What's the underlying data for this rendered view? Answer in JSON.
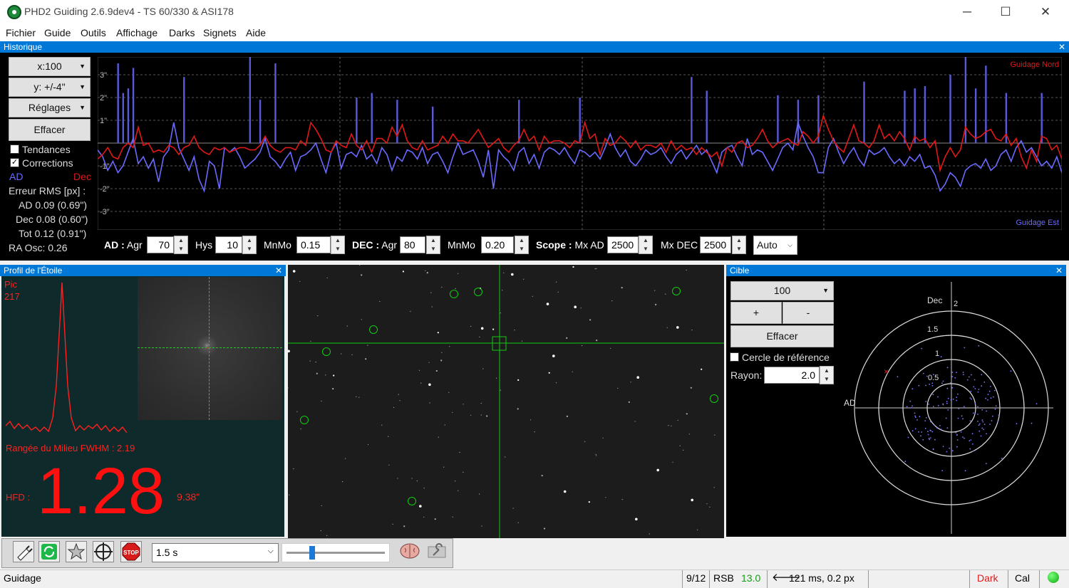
{
  "window": {
    "title": "PHD2 Guiding 2.6.9dev4 - TS 60/330 & ASI178",
    "minimize": "─",
    "maximize": "☐",
    "close": "✕"
  },
  "menu": [
    "Fichier",
    "Guide",
    "Outils",
    "Affichage",
    "Darks",
    "Signets",
    "Aide"
  ],
  "history": {
    "title": "Historique",
    "close": "✕",
    "x_scale": "x:100",
    "y_scale": "y: +/-4\"",
    "settings": "Réglages",
    "clear": "Effacer",
    "trends_label": "Tendances",
    "trends_checked": false,
    "corrections_label": "Corrections",
    "corrections_checked": true,
    "ra_label": "AD",
    "dec_label": "Dec",
    "rms_title": "Erreur RMS [px] :",
    "rms_ra": "AD 0.09 (0.69\")",
    "rms_dec": "Dec 0.08 (0.60\")",
    "rms_tot": "Tot 0.12 (0.91\")",
    "ra_osc": "RA Osc: 0.26",
    "y_ticks": [
      "3\"",
      "2\"",
      "1\"",
      "-1\"",
      "-2\"",
      "-3\""
    ],
    "north_label": "Guidage Nord",
    "east_label": "Guidage Est",
    "colors": {
      "ra": "#6a6aff",
      "dec": "#e01818"
    },
    "ra_series": [
      -0.3,
      -0.6,
      -1.2,
      -0.8,
      -1.3,
      -1.0,
      -0.4,
      0.2,
      -0.9,
      -0.6,
      -1.1,
      -0.7,
      -1.7,
      -0.6,
      -0.3,
      0.9,
      -0.2,
      -0.7,
      -1.2,
      -0.6,
      -1.6,
      -2.1,
      -0.8,
      -1.0,
      -2.0,
      -0.2,
      -0.4,
      -0.2,
      -0.6,
      -1.1,
      -0.9,
      -0.7,
      -0.4,
      0.2,
      -0.6,
      -0.8,
      -1.1,
      -0.7,
      -0.4,
      -1.2,
      -0.6,
      -0.5,
      -0.3,
      0.0,
      -0.7,
      -1.3,
      -0.4,
      0.0,
      -1.1,
      -0.5,
      -0.4,
      -0.6,
      -0.1,
      -0.7,
      -0.5,
      -0.9,
      -0.2,
      -0.5,
      -1.2,
      -0.6,
      -0.8,
      -0.3,
      -0.4,
      -0.7,
      -0.2,
      -0.9,
      -0.5,
      -0.4,
      -0.8,
      -1.3,
      -0.6,
      0.0,
      -0.5,
      -0.4,
      -0.3,
      -0.8,
      -1.5,
      -0.3,
      -2.0,
      -0.3,
      -0.6,
      -0.8,
      -1.2,
      -0.4,
      -0.2,
      -0.9,
      -0.5,
      -1.1,
      -0.4,
      -0.2,
      -0.3,
      -0.5,
      -0.2,
      -0.6,
      -0.9,
      -0.3,
      -0.4,
      -0.6,
      -0.4,
      -0.7,
      -0.2,
      0.4,
      -0.2,
      -0.6,
      -0.3,
      -0.8,
      -1.0,
      -0.7,
      -0.3,
      -0.5,
      -0.4,
      -0.2,
      -0.6,
      -0.9,
      -0.5,
      -0.3,
      -0.7,
      -0.4,
      -0.1,
      -0.5,
      -0.3,
      -0.8,
      -1.3,
      -0.4,
      -0.2,
      -0.1,
      -0.6,
      -1.0,
      0.2,
      -0.5,
      -0.3,
      -0.4,
      -0.8,
      -1.2,
      -0.7,
      -0.2,
      0.0,
      -0.3,
      0.9,
      0.3,
      -0.2,
      -0.6,
      -1.3,
      -1.3,
      -0.2,
      0.2,
      -0.4,
      -0.9,
      -0.5,
      -0.2,
      -0.7,
      -1.0,
      -0.3,
      -0.5,
      -0.4,
      -0.2,
      -0.6,
      -0.9,
      -0.7,
      -1.0,
      -0.6,
      -0.8,
      -0.5,
      -1.1,
      -1.0,
      -1.4,
      -2.1,
      -1.8,
      -1.3,
      -1.5,
      -1.9,
      -1.2,
      -1.0,
      -0.9,
      -1.1,
      -0.7,
      -1.2,
      -1.0,
      -0.5,
      -0.3,
      -0.8,
      -0.2,
      0.1,
      -0.4,
      -0.2,
      -0.6,
      -1.0,
      -0.8,
      -1.1,
      -0.6,
      -1.3
    ],
    "dec_series": [
      -0.7,
      -0.5,
      -0.2,
      -0.6,
      -0.7,
      -0.2,
      0.0,
      -0.2,
      0.7,
      -0.1,
      0.0,
      -0.4,
      -0.3,
      -0.4,
      -0.1,
      -0.2,
      -0.5,
      -0.2,
      -0.1,
      0.3,
      -0.2,
      -0.4,
      -0.5,
      -0.2,
      -0.3,
      -0.2,
      -0.4,
      -0.3,
      -0.2,
      -0.2,
      -0.3,
      -0.3,
      -0.1,
      0.3,
      -0.1,
      -0.3,
      -0.4,
      -0.2,
      -0.2,
      -0.3,
      0.1,
      -0.1,
      0.9,
      0.6,
      0.2,
      -0.3,
      -0.4,
      0.1,
      -0.1,
      -0.2,
      0.4,
      -0.1,
      -0.3,
      0.1,
      -0.4,
      0.2,
      0.2,
      0.0,
      0.7,
      0.3,
      0.8,
      0.1,
      -0.2,
      -0.3,
      0.1,
      -0.3,
      -0.2,
      -0.1,
      0.3,
      0.0,
      0.4,
      0.1,
      0.1,
      0.0,
      0.3,
      0.6,
      0.2,
      -0.2,
      0.0,
      0.2,
      -0.2,
      -0.4,
      -0.1,
      0.1,
      0.6,
      0.1,
      0.3,
      -0.3,
      0.3,
      0.0,
      0.1,
      0.1,
      0.0,
      -0.2,
      0.1,
      0.0,
      0.9,
      0.2,
      0.4,
      -0.5,
      0.2,
      -0.1,
      0.0,
      0.3,
      0.1,
      -0.2,
      0.1,
      -0.3,
      -0.1,
      -0.1,
      -0.2,
      0.0,
      -0.4,
      0.1,
      -0.3,
      -0.1,
      -0.3,
      -0.2,
      -0.5,
      -0.2,
      -0.4,
      -0.6,
      -0.4,
      -1.0,
      -0.2,
      -0.4,
      0.0,
      0.1,
      -0.2,
      -0.1,
      0.2,
      0.6,
      0.1,
      -0.2,
      0.0,
      0.1,
      0.2,
      0.0,
      -0.1,
      0.5,
      0.3,
      0.0,
      0.3,
      1.2,
      0.6,
      0.1,
      -0.2,
      -0.4,
      0.2,
      0.8,
      0.1,
      0.0,
      -0.2,
      0.1,
      0.8,
      0.2,
      0.4,
      0.1,
      0.5,
      0.2,
      -0.3,
      0.3,
      0.1,
      0.2,
      -0.2,
      0.1,
      -1.2,
      -0.6,
      -0.2,
      -0.6,
      -0.3,
      0.7,
      0.4,
      0.2,
      0.3,
      0.5,
      0.6,
      0.2,
      0.1,
      0.4,
      -0.1,
      0.2,
      -0.6,
      -1.1,
      -0.3,
      -0.8,
      0.3,
      0.2,
      -0.3,
      -0.1,
      -0.7,
      -0.6
    ],
    "ra_pulses": [
      {
        "i": 4,
        "h": 3.5
      },
      {
        "i": 5,
        "h": 2.2
      },
      {
        "i": 6,
        "h": 2.4
      },
      {
        "i": 7,
        "h": 3.3
      },
      {
        "i": 17,
        "h": 2.9
      },
      {
        "i": 30,
        "h": 3.8
      },
      {
        "i": 32,
        "h": 1.9
      },
      {
        "i": 35,
        "h": 3.5
      },
      {
        "i": 51,
        "h": 2.0
      },
      {
        "i": 54,
        "h": 2.2
      },
      {
        "i": 59,
        "h": 1.9
      },
      {
        "i": 66,
        "h": 1.6
      },
      {
        "i": 83,
        "h": 1.9
      },
      {
        "i": 95,
        "h": 2.0
      },
      {
        "i": 117,
        "h": 2.9
      },
      {
        "i": 120,
        "h": 2.3
      },
      {
        "i": 134,
        "h": 2.1
      },
      {
        "i": 138,
        "h": 1.9
      },
      {
        "i": 142,
        "h": 2.1
      },
      {
        "i": 151,
        "h": 2.7
      },
      {
        "i": 159,
        "h": 2.3
      },
      {
        "i": 161,
        "h": 2.4
      },
      {
        "i": 163,
        "h": 2.5
      },
      {
        "i": 168,
        "h": 3.0
      },
      {
        "i": 171,
        "h": 3.8
      },
      {
        "i": 173,
        "h": 2.4
      },
      {
        "i": 175,
        "h": 3.4
      },
      {
        "i": 179,
        "h": 2.2
      },
      {
        "i": 186,
        "h": 2.2
      },
      {
        "i": 191,
        "h": 2.3
      }
    ],
    "dec_pulses": [],
    "ra_agr_label": "AD :",
    "agr_label": "Agr",
    "ra_agr": "70",
    "hys_label": "Hys",
    "hys": "10",
    "mnmo_label": "MnMo",
    "ra_mnmo": "0.15",
    "dec_label_ctl": "DEC :",
    "dec_agr": "80",
    "dec_mnmo": "0.20",
    "scope_label": "Scope :",
    "mx_ad_label": "Mx AD",
    "mx_ad": "2500",
    "mx_dec_label": "Mx DEC",
    "mx_dec": "2500",
    "dec_mode": "Auto"
  },
  "star_profile": {
    "title": "Profil de l'Étoile",
    "close": "✕",
    "peak_label": "Pic",
    "peak": "217",
    "fwhm": "Rangée du Milieu FWHM : 2.19",
    "hfd_label": "HFD :",
    "hfd": "1.28",
    "hfd_arcsec": "9.38\""
  },
  "target": {
    "title": "Cible",
    "close": "✕",
    "scale": "100",
    "plus": "+",
    "minus": "-",
    "clear": "Effacer",
    "ref_circle": "Cercle de référence",
    "ref_checked": false,
    "radius_label": "Rayon:",
    "radius": "2.0",
    "dec_axis": "Dec",
    "ra_axis": "AD",
    "ring_labels": [
      "2",
      "1.5",
      "1",
      "0.5"
    ]
  },
  "toolbar": {
    "exposure": "1.5 s"
  },
  "status": {
    "state": "Guidage",
    "frame": "9/12",
    "snr_label": "RSB",
    "snr": "13.0",
    "pulse": "121 ms, 0.2 px",
    "dark": "Dark",
    "cal": "Cal"
  }
}
